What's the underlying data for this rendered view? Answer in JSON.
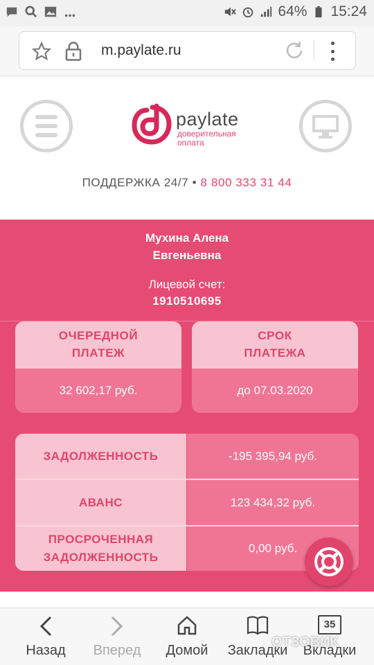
{
  "status_bar": {
    "battery": "64%",
    "time": "15:24",
    "icons_left": [
      "chat-icon",
      "search-icon",
      "image-icon",
      "more-dots-icon"
    ],
    "icons_right": [
      "mute-icon",
      "alarm-icon",
      "signal-icon",
      "battery-icon"
    ]
  },
  "browser": {
    "url": "m.paylate.ru"
  },
  "header": {
    "logo_name": "paylate",
    "logo_tagline": "доверительная оплата",
    "support_label": "ПОДДЕРЖКА 24/7 •",
    "support_phone": "8 800 333 31 44"
  },
  "account": {
    "name_line1": "Мухина Алена",
    "name_line2": "Евгеньевна",
    "account_label": "Лицевой счет:",
    "account_number": "1910510695"
  },
  "cards": [
    {
      "title_line1": "ОЧЕРЕДНОЙ",
      "title_line2": "ПЛАТЕЖ",
      "value": "32 602,17 руб."
    },
    {
      "title_line1": "СРОК",
      "title_line2": "ПЛАТЕЖА",
      "value": "до 07.03.2020"
    }
  ],
  "summary": [
    {
      "label": "ЗАДОЛЖЕННОСТЬ",
      "value": "-195 395,94 руб."
    },
    {
      "label": "АВАНС",
      "value": "123 434,32 руб."
    },
    {
      "label": "ПРОСРОЧЕННАЯ ЗАДОЛЖЕННОСТЬ",
      "value": "0,00 руб."
    }
  ],
  "bottom_nav": {
    "back": "Назад",
    "forward": "Вперед",
    "home": "Домой",
    "bookmarks": "Закладки",
    "tabs": "Вкладки",
    "tabs_count": "35"
  },
  "watermark": "ОТЗОВИК",
  "colors": {
    "brand_pink": "#e64b73",
    "light_pink": "#f9c4d1",
    "mid_pink": "#f07594"
  }
}
